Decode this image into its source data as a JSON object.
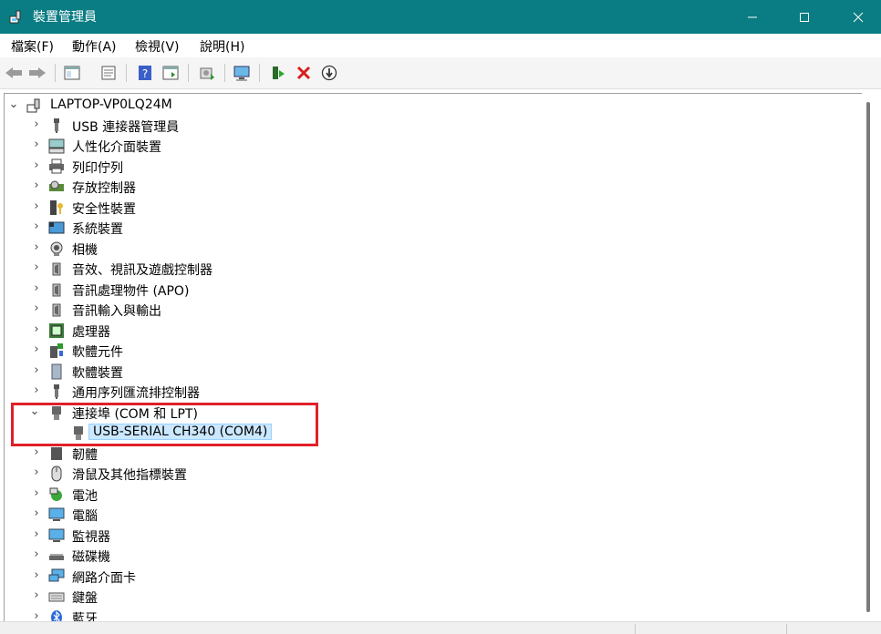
{
  "window": {
    "title": "裝置管理員",
    "accent": "#0a7c83",
    "controls": [
      "minimize-icon",
      "maximize-icon",
      "close-icon"
    ]
  },
  "menu": [
    "檔案(F)",
    "動作(A)",
    "檢視(V)",
    "說明(H)"
  ],
  "toolbar": [
    "back-icon",
    "forward-icon",
    "show-hide-console-tree-icon",
    "properties-icon",
    "help-icon",
    "action-pane-icon",
    "update-driver-icon",
    "scan-hardware-icon",
    "enable-device-icon",
    "uninstall-device-icon",
    "disable-device-icon"
  ],
  "tree": {
    "root": "LAPTOP-VP0LQ24M",
    "items": [
      {
        "label": "USB 連接器管理員",
        "icon": "usb-connector-icon",
        "expanded": false
      },
      {
        "label": "人性化介面裝置",
        "icon": "hid-icon",
        "expanded": false
      },
      {
        "label": "列印佇列",
        "icon": "printer-icon",
        "expanded": false
      },
      {
        "label": "存放控制器",
        "icon": "storage-controller-icon",
        "expanded": false
      },
      {
        "label": "安全性裝置",
        "icon": "security-device-icon",
        "expanded": false
      },
      {
        "label": "系統裝置",
        "icon": "system-device-icon",
        "expanded": false
      },
      {
        "label": "相機",
        "icon": "camera-icon",
        "expanded": false
      },
      {
        "label": "音效、視訊及遊戲控制器",
        "icon": "speaker-icon",
        "expanded": false
      },
      {
        "label": "音訊處理物件 (APO)",
        "icon": "speaker-icon",
        "expanded": false
      },
      {
        "label": "音訊輸入與輸出",
        "icon": "speaker-icon",
        "expanded": false
      },
      {
        "label": "處理器",
        "icon": "processor-icon",
        "expanded": false
      },
      {
        "label": "軟體元件",
        "icon": "software-component-icon",
        "expanded": false
      },
      {
        "label": "軟體裝置",
        "icon": "software-device-icon",
        "expanded": false
      },
      {
        "label": "通用序列匯流排控制器",
        "icon": "usb-controller-icon",
        "expanded": false
      },
      {
        "label": "連接埠 (COM 和 LPT)",
        "icon": "port-icon",
        "expanded": true,
        "children": [
          "USB-SERIAL CH340 (COM4)"
        ]
      },
      {
        "label": "韌體",
        "icon": "firmware-icon",
        "expanded": false
      },
      {
        "label": "滑鼠及其他指標裝置",
        "icon": "mouse-icon",
        "expanded": false
      },
      {
        "label": "電池",
        "icon": "battery-icon",
        "expanded": false
      },
      {
        "label": "電腦",
        "icon": "computer-icon",
        "expanded": false
      },
      {
        "label": "監視器",
        "icon": "monitor-icon",
        "expanded": false
      },
      {
        "label": "磁碟機",
        "icon": "disk-drive-icon",
        "expanded": false
      },
      {
        "label": "網路介面卡",
        "icon": "network-adapter-icon",
        "expanded": false
      },
      {
        "label": "鍵盤",
        "icon": "keyboard-icon",
        "expanded": false
      },
      {
        "label": "藍牙",
        "icon": "bluetooth-icon",
        "expanded": false
      }
    ],
    "selected": "USB-SERIAL CH340 (COM4)"
  },
  "highlight_color": "#e0202a"
}
